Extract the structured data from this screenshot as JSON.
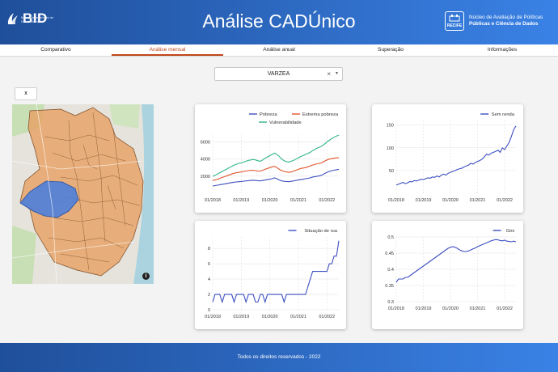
{
  "header": {
    "logo_text": "BID",
    "logo_subtitle": "Banco Interamericano de Desenvolvimento",
    "title": "Análise CADÚnico",
    "nucleo_line1": "Núcleo de Avaliação de Políticas",
    "nucleo_line2": "Públicas e Ciência de Dados",
    "nucleo_badge": "RECIFE"
  },
  "tabs": [
    {
      "label": "Comparativo",
      "active": false
    },
    {
      "label": "Análise mensal",
      "active": true
    },
    {
      "label": "Análise anual",
      "active": false
    },
    {
      "label": "Superação",
      "active": false
    },
    {
      "label": "Informações",
      "active": false
    }
  ],
  "selector": {
    "value": "VARZEA",
    "clear": "×",
    "caret": "▼"
  },
  "map": {
    "reset_label": "x",
    "info_icon": "i",
    "highlight_color": "#4d7fd9",
    "region_color": "#e6a46a"
  },
  "footer": {
    "text": "Todos os direitos reservados - 2022"
  },
  "chart_data": [
    {
      "type": "line",
      "id": "poverty",
      "x_ticks": [
        "01/2018",
        "01/2019",
        "01/2020",
        "01/2021",
        "01/2022"
      ],
      "x_start": "2018-01",
      "x_end": "2022-06",
      "ylim": [
        0,
        7000
      ],
      "y_ticks": [
        2000,
        4000,
        6000
      ],
      "series": [
        {
          "name": "Pobreza",
          "color": "#3d4fbf",
          "values": [
            850,
            900,
            950,
            1000,
            1050,
            1100,
            1150,
            1200,
            1250,
            1300,
            1320,
            1350,
            1380,
            1420,
            1450,
            1480,
            1500,
            1520,
            1500,
            1480,
            1450,
            1500,
            1550,
            1600,
            1650,
            1700,
            1800,
            1700,
            1550,
            1450,
            1400,
            1380,
            1350,
            1400,
            1450,
            1500,
            1550,
            1600,
            1650,
            1700,
            1750,
            1800,
            1900,
            1950,
            2000,
            2050,
            2150,
            2300,
            2450,
            2550,
            2650,
            2700,
            2750,
            2800
          ]
        },
        {
          "name": "Extrema pobreza",
          "color": "#e0552b",
          "values": [
            1500,
            1550,
            1650,
            1750,
            1850,
            1950,
            2050,
            2150,
            2250,
            2350,
            2400,
            2450,
            2500,
            2550,
            2600,
            2650,
            2680,
            2700,
            2650,
            2600,
            2600,
            2700,
            2800,
            2900,
            3000,
            3100,
            3150,
            3000,
            2800,
            2650,
            2550,
            2500,
            2450,
            2500,
            2600,
            2700,
            2800,
            2900,
            2950,
            3000,
            3100,
            3200,
            3300,
            3400,
            3450,
            3500,
            3600,
            3750,
            3900,
            4000,
            4050,
            4100,
            4150,
            4150
          ]
        },
        {
          "name": "Vulnerabilidade",
          "color": "#2fb58a",
          "values": [
            2000,
            2100,
            2250,
            2400,
            2550,
            2700,
            2850,
            3000,
            3150,
            3300,
            3400,
            3500,
            3550,
            3650,
            3750,
            3850,
            3900,
            3950,
            3900,
            3800,
            3750,
            3900,
            4100,
            4250,
            4400,
            4550,
            4700,
            4550,
            4300,
            4000,
            3800,
            3700,
            3650,
            3750,
            3850,
            4000,
            4150,
            4300,
            4400,
            4550,
            4650,
            4800,
            5000,
            5150,
            5300,
            5400,
            5550,
            5750,
            6000,
            6200,
            6400,
            6550,
            6700,
            6800
          ]
        }
      ]
    },
    {
      "type": "line",
      "id": "sem-renda",
      "x_ticks": [
        "01/2018",
        "01/2019",
        "01/2020",
        "01/2021",
        "01/2022"
      ],
      "x_start": "2018-01",
      "x_end": "2022-06",
      "ylim": [
        0,
        160
      ],
      "y_ticks": [
        50,
        100,
        150
      ],
      "series": [
        {
          "name": "Sem renda",
          "color": "#3d4fbf",
          "values": [
            18,
            20,
            22,
            24,
            21,
            23,
            26,
            25,
            28,
            27,
            29,
            31,
            30,
            32,
            34,
            33,
            36,
            35,
            38,
            36,
            40,
            42,
            40,
            44,
            46,
            48,
            50,
            52,
            54,
            55,
            58,
            60,
            62,
            66,
            64,
            68,
            70,
            72,
            75,
            80,
            86,
            84,
            88,
            90,
            92,
            95,
            90,
            100,
            96,
            104,
            112,
            125,
            140,
            148
          ]
        }
      ]
    },
    {
      "type": "line",
      "id": "situacao-rua",
      "x_ticks": [
        "01/2018",
        "01/2019",
        "01/2020",
        "01/2021",
        "01/2022"
      ],
      "x_start": "2018-01",
      "x_end": "2022-06",
      "ylim": [
        0,
        9.5
      ],
      "y_ticks": [
        0,
        2,
        4,
        6,
        8
      ],
      "series": [
        {
          "name": "Situação de rua",
          "color": "#3d4fbf",
          "values": [
            1,
            2,
            2,
            2,
            1,
            2,
            2,
            2,
            2,
            1,
            2,
            2,
            2,
            2,
            1,
            2,
            2,
            2,
            1,
            1,
            2,
            2,
            1,
            2,
            2,
            2,
            2,
            2,
            2,
            2,
            1,
            2,
            2,
            2,
            2,
            2,
            2,
            2,
            2,
            2,
            3,
            4,
            5,
            5,
            5,
            5,
            5,
            5,
            5,
            6,
            6,
            7,
            7,
            9
          ]
        }
      ]
    },
    {
      "type": "line",
      "id": "gini",
      "x_ticks": [
        "01/2018",
        "01/2019",
        "01/2020",
        "01/2021",
        "01/2022"
      ],
      "x_start": "2018-01",
      "x_end": "2022-06",
      "ylim": [
        0.3,
        0.5
      ],
      "y_ticks": [
        0.3,
        0.35,
        0.4,
        0.45,
        0.5
      ],
      "series": [
        {
          "name": "Gini",
          "color": "#3d4fbf",
          "values": [
            0.36,
            0.37,
            0.37,
            0.37,
            0.375,
            0.375,
            0.38,
            0.385,
            0.39,
            0.395,
            0.4,
            0.405,
            0.41,
            0.415,
            0.42,
            0.425,
            0.43,
            0.435,
            0.44,
            0.445,
            0.45,
            0.455,
            0.46,
            0.465,
            0.468,
            0.47,
            0.468,
            0.465,
            0.46,
            0.457,
            0.455,
            0.455,
            0.457,
            0.46,
            0.463,
            0.466,
            0.47,
            0.473,
            0.476,
            0.479,
            0.482,
            0.485,
            0.488,
            0.49,
            0.492,
            0.491,
            0.489,
            0.488,
            0.49,
            0.487,
            0.486,
            0.485,
            0.487,
            0.485
          ]
        }
      ]
    }
  ]
}
